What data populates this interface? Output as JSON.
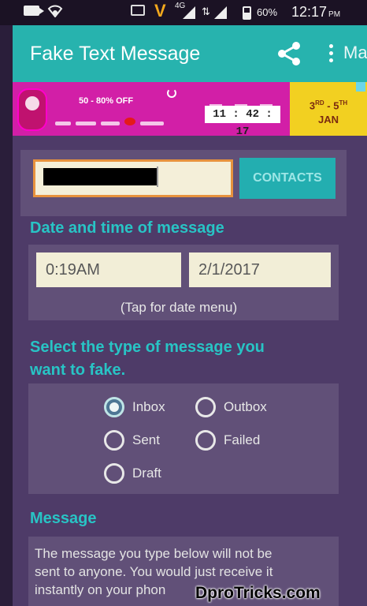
{
  "status_bar": {
    "battery": "60%",
    "time": "12:17",
    "ampm": "PM",
    "carrier_logo": "V",
    "network": "4G"
  },
  "app_bar": {
    "title": "Fake Text Message",
    "more_label": "Ma",
    "share_icon": "share-icon",
    "more_icon": "overflow-menu-icon"
  },
  "ad": {
    "sale_text": "50 - 80% OFF",
    "timer": "11 : 42 : 17",
    "dates_line1": "3",
    "dates_sup1": "RD",
    "dates_sep": " - 5",
    "dates_sup2": "TH",
    "dates_line2": "JAN"
  },
  "contact": {
    "phone_value": "",
    "contacts_button": "CONTACTS"
  },
  "datetime": {
    "section_title": "Date and time of message",
    "time_value": "0:19AM",
    "date_value": "2/1/2017",
    "hint": "(Tap for date menu)"
  },
  "message_type": {
    "section_title_line1": "Select the type of message you",
    "section_title_line2": "want to fake.",
    "options": [
      {
        "label": "Inbox",
        "selected": true
      },
      {
        "label": "Outbox",
        "selected": false
      },
      {
        "label": "Sent",
        "selected": false
      },
      {
        "label": "Failed",
        "selected": false
      },
      {
        "label": "Draft",
        "selected": false
      }
    ]
  },
  "message": {
    "section_title": "Message",
    "text_line1": "The message you type below will not be",
    "text_line2": "sent to anyone. You would just receive it",
    "text_line3": "instantly on your phon"
  },
  "watermark": "DproTricks.com",
  "colors": {
    "accent": "#27b3ae",
    "heading": "#28c4c5",
    "background": "#4e3b68",
    "card": "#615078",
    "input_border": "#e7923e"
  }
}
